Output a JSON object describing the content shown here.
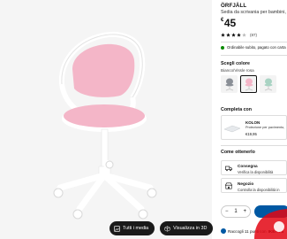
{
  "product": {
    "name": "ÖRFJÄLL",
    "description": "Sedia da scrivania per bambini,",
    "currency": "€",
    "price": "45",
    "rating_count": "(87)"
  },
  "delivery": {
    "text": "Ordinabile subito, pagato con carta"
  },
  "colors": {
    "heading": "Scegli colore",
    "selected": "Bianco/Vissle rosa",
    "swatches": [
      "grey",
      "pink",
      "green"
    ]
  },
  "complete_look": {
    "heading": "Completa con",
    "name": "KOLON",
    "description": "Protezione per pavimento,",
    "price": "€19,95"
  },
  "fulfillment": {
    "heading": "Come ottenerlo",
    "options": [
      {
        "title": "Consegna",
        "subtitle": "Verifica la disponibilità",
        "icon": "truck-icon"
      },
      {
        "title": "Negozio",
        "subtitle": "Controlla la disponibilità in",
        "icon": "store-icon"
      }
    ]
  },
  "image_controls": {
    "all_media": "Tutti i media",
    "view_3d": "Visualizza in 3D"
  },
  "loyalty": {
    "prefix": "Raccogli 11 punti con",
    "brand": "IKEA Fa"
  },
  "quantity": {
    "minus": "−",
    "value": "1",
    "plus": "+"
  },
  "colors_hex": {
    "accent": "#0058a3",
    "seat_pink": "#f4b6c8",
    "frame_white": "#ffffff",
    "badge_red": "#e30613"
  }
}
